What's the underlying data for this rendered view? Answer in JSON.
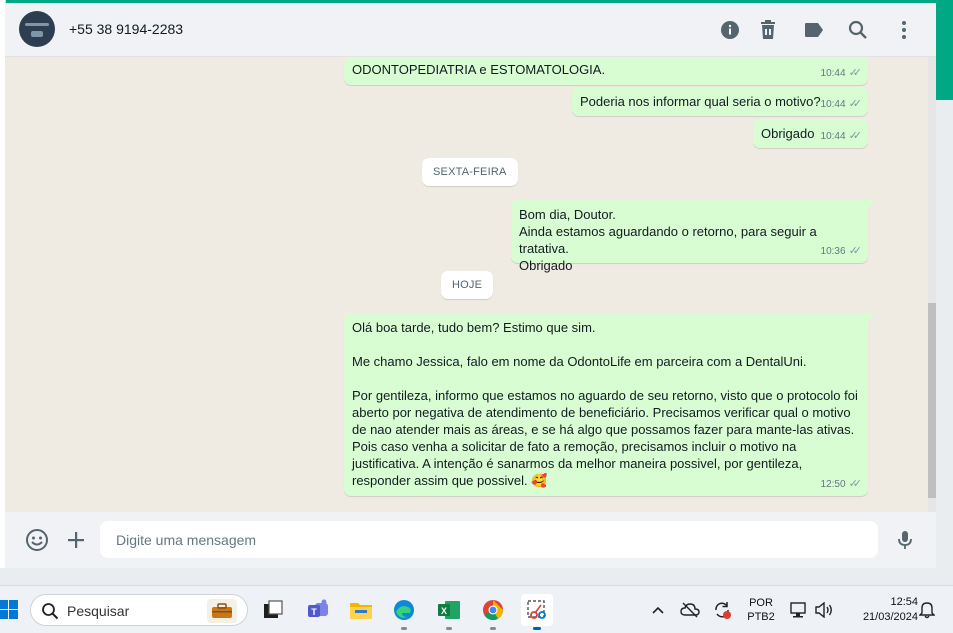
{
  "window": {
    "contact_name": "+55 38 9194-2283",
    "avatar_name": "contact-avatar"
  },
  "header_icons": [
    "info-icon",
    "trash-icon",
    "label-icon",
    "search-icon",
    "menu-icon"
  ],
  "messages": [
    {
      "text": "ODONTOPEDIATRIA e ESTOMATOLOGIA.",
      "time": "10:44",
      "status": "read"
    },
    {
      "text": "Poderia nos informar qual seria o motivo?",
      "time": "10:44",
      "status": "read"
    },
    {
      "text": "Obrigado",
      "time": "10:44",
      "status": "read"
    },
    {
      "text": "Bom dia, Doutor.\nAinda estamos aguardando o retorno, para seguir a tratativa.\nObrigado",
      "time": "10:36",
      "status": "read"
    },
    {
      "text": "Olá boa tarde, tudo bem? Estimo que sim.\n\nMe chamo Jessica, falo em nome da OdontoLife em parceira com a DentalUni.\n\nPor gentileza, informo que estamos no aguardo de seu retorno, visto que o protocolo foi aberto por negativa de atendimento de beneficiário. Precisamos verificar qual o motivo de nao atender mais as áreas, e se há algo que possamos fazer para mante-las ativas. Pois caso venha a solicitar de fato a remoção, precisamos incluir o motivo na justificativa. A intenção é sanarmos da melhor maneira possivel, por gentileza, responder assim que possivel. 🥰",
      "time": "12:50",
      "status": "read"
    }
  ],
  "day_chips": {
    "friday": "SEXTA-FEIRA",
    "today": "HOJE"
  },
  "composer": {
    "placeholder": "Digite uma mensagem",
    "value": ""
  },
  "taskbar": {
    "search_label": "Pesquisar",
    "apps": [
      "briefcase-icon",
      "snap-icon",
      "teams-icon",
      "file-explorer-icon",
      "edge-icon",
      "excel-icon",
      "chrome-icon",
      "snipping-tool-icon"
    ],
    "lang_line1": "POR",
    "lang_line2": "PTB2",
    "time": "12:54",
    "date": "21/03/2024"
  },
  "colors": {
    "accent": "#00a884",
    "bubble_out": "#d9fdd3",
    "chat_bg": "#efeae2",
    "header_bg": "#f0f2f5"
  }
}
